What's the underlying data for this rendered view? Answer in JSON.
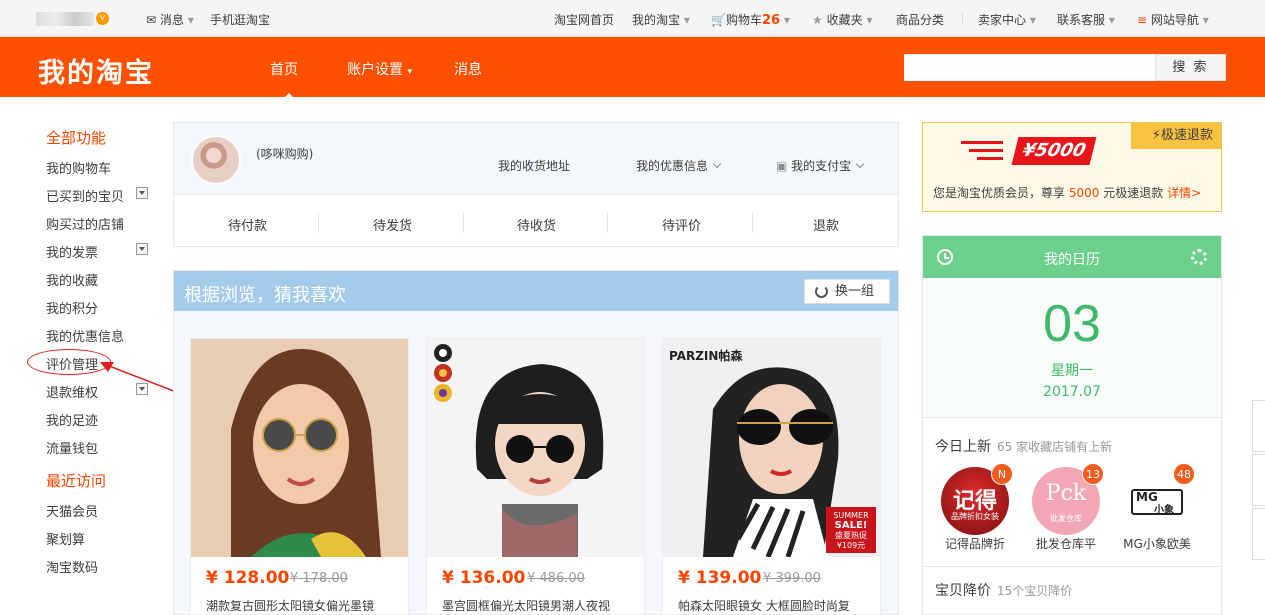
{
  "topbar": {
    "messages": "消息",
    "mobile": "手机逛淘宝",
    "home": "淘宝网首页",
    "my_taobao": "我的淘宝",
    "cart": "购物车",
    "cart_count": "26",
    "favorites": "收藏夹",
    "categories": "商品分类",
    "seller": "卖家中心",
    "contact": "联系客服",
    "sitenav": "网站导航"
  },
  "header": {
    "logo": "我的淘宝",
    "nav_home": "首页",
    "nav_account": "账户设置",
    "nav_messages": "消息",
    "search_button": "搜 索",
    "search_value": ""
  },
  "sidebar": {
    "all_title": "全部功能",
    "items": [
      "我的购物车",
      "已买到的宝贝",
      "购买过的店铺",
      "我的发票",
      "我的收藏",
      "我的积分",
      "我的优惠信息",
      "评价管理",
      "退款维权",
      "我的足迹",
      "流量钱包"
    ],
    "recent_title": "最近访问",
    "recent": [
      "天猫会员",
      "聚划算",
      "淘宝数码"
    ]
  },
  "profile": {
    "username": "(哆咪购购)",
    "address": "我的收货地址",
    "coupons": "我的优惠信息",
    "alipay": "我的支付宝",
    "tabs": [
      "待付款",
      "待发货",
      "待收货",
      "待评价",
      "退款"
    ]
  },
  "recommend": {
    "title": "根据浏览，猜我喜欢",
    "swap": "换一组",
    "products": [
      {
        "price": "¥ 128.00",
        "old": "¥ 178.00",
        "desc": "潮款复古圆形太阳镜女偏光墨镜"
      },
      {
        "price": "¥ 136.00",
        "old": "¥ 486.00",
        "desc": "墨宫圆框偏光太阳镜男潮人夜视"
      },
      {
        "price": "¥ 139.00",
        "old": "¥ 399.00",
        "desc": "帕森太阳眼镜女 大框圆脸时尚复"
      }
    ],
    "brand": "PARZIN帕森",
    "sale_line1": "SUMMER",
    "sale_line2": "SALE!",
    "sale_line3": "盛夏热促",
    "sale_price": "¥109元"
  },
  "promo": {
    "corner": "极速退款",
    "amount": "¥5000",
    "text_a": "您是淘宝优质会员，尊享",
    "text_num": "5000",
    "text_b": "元极速退款",
    "text_link": "详情>"
  },
  "calendar": {
    "title": "我的日历",
    "day": "03",
    "weekday": "星期一",
    "month": "2017.07",
    "today_title": "今日上新",
    "today_sub": "65 家收藏店铺有上新",
    "shops": [
      {
        "name": "记得品牌折",
        "badge": "N",
        "logo_text": "记得",
        "logo_sub": "品牌折扣女装"
      },
      {
        "name": "批发仓库平",
        "badge": "13",
        "logo_text": "Pck",
        "logo_sub": "批发仓库"
      },
      {
        "name": "MG小象欧美",
        "badge": "48",
        "logo_text": "MG",
        "logo_sub": "小象"
      }
    ],
    "drop_title": "宝贝降价",
    "drop_sub": "15个宝贝降价"
  },
  "colors": {
    "brand": "#ff5000",
    "accent_green": "#3fb86a",
    "rec_header": "#a4cbe9"
  }
}
